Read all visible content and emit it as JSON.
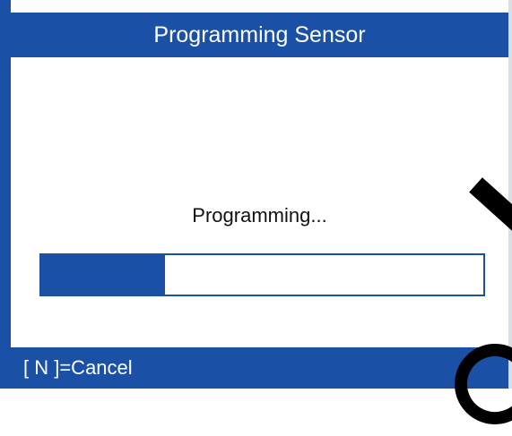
{
  "header": {
    "title": "Programming Sensor"
  },
  "main": {
    "status_message": "Programming...",
    "progress_fraction": 0.28
  },
  "footer": {
    "hint": "[ N ]=Cancel"
  },
  "colors": {
    "accent": "#1a50a6",
    "background": "#ffffff",
    "text_on_accent": "#ffffff"
  }
}
